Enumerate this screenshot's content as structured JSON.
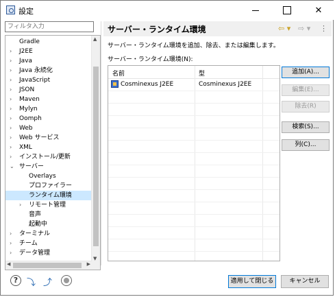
{
  "window": {
    "title": "設定",
    "minimize": "—",
    "maximize": "□",
    "close": "✕"
  },
  "filter": {
    "placeholder": "フィルタ入力"
  },
  "tree": [
    {
      "label": "Gradle",
      "arrow": "",
      "indent": 0
    },
    {
      "label": "J2EE",
      "arrow": "›",
      "indent": 0
    },
    {
      "label": "Java",
      "arrow": "›",
      "indent": 0
    },
    {
      "label": "Java 永続化",
      "arrow": "›",
      "indent": 0
    },
    {
      "label": "JavaScript",
      "arrow": "›",
      "indent": 0
    },
    {
      "label": "JSON",
      "arrow": "›",
      "indent": 0
    },
    {
      "label": "Maven",
      "arrow": "›",
      "indent": 0
    },
    {
      "label": "Mylyn",
      "arrow": "›",
      "indent": 0
    },
    {
      "label": "Oomph",
      "arrow": "›",
      "indent": 0
    },
    {
      "label": "Web",
      "arrow": "›",
      "indent": 0
    },
    {
      "label": "Web サービス",
      "arrow": "›",
      "indent": 0
    },
    {
      "label": "XML",
      "arrow": "›",
      "indent": 0
    },
    {
      "label": "インストール/更新",
      "arrow": "›",
      "indent": 0
    },
    {
      "label": "サーバー",
      "arrow": "⌄",
      "indent": 0
    },
    {
      "label": "Overlays",
      "arrow": "",
      "indent": 1
    },
    {
      "label": "プロファイラー",
      "arrow": "",
      "indent": 1
    },
    {
      "label": "ランタイム環境",
      "arrow": "",
      "indent": 1,
      "selected": true
    },
    {
      "label": "リモート管理",
      "arrow": "›",
      "indent": 1
    },
    {
      "label": "音声",
      "arrow": "",
      "indent": 1
    },
    {
      "label": "起動中",
      "arrow": "",
      "indent": 1
    },
    {
      "label": "ターミナル",
      "arrow": "›",
      "indent": 0
    },
    {
      "label": "チーム",
      "arrow": "›",
      "indent": 0
    },
    {
      "label": "データ管理",
      "arrow": "›",
      "indent": 0
    }
  ],
  "page": {
    "title": "サーバー・ランタイム環境",
    "nav_back": "⇦ ▾",
    "nav_forward": "⇨ ▾",
    "nav_menu": "⋮",
    "description": "サーバー・ランタイム環境を追加、除去、または編集します。",
    "table_label": "サーバー・ランタイム環境(N):"
  },
  "table": {
    "columns": [
      "名前",
      "型"
    ],
    "rows": [
      {
        "name": "Cosminexus J2EE",
        "type": "Cosminexus J2EE"
      }
    ]
  },
  "buttons": {
    "add": "追加(A)...",
    "edit": "編集(E)...",
    "remove": "除去(R)",
    "search": "検索(S)...",
    "columns": "列(C)..."
  },
  "footer": {
    "help": "?",
    "apply_close": "適用して閉じる",
    "cancel": "キャンセル"
  }
}
